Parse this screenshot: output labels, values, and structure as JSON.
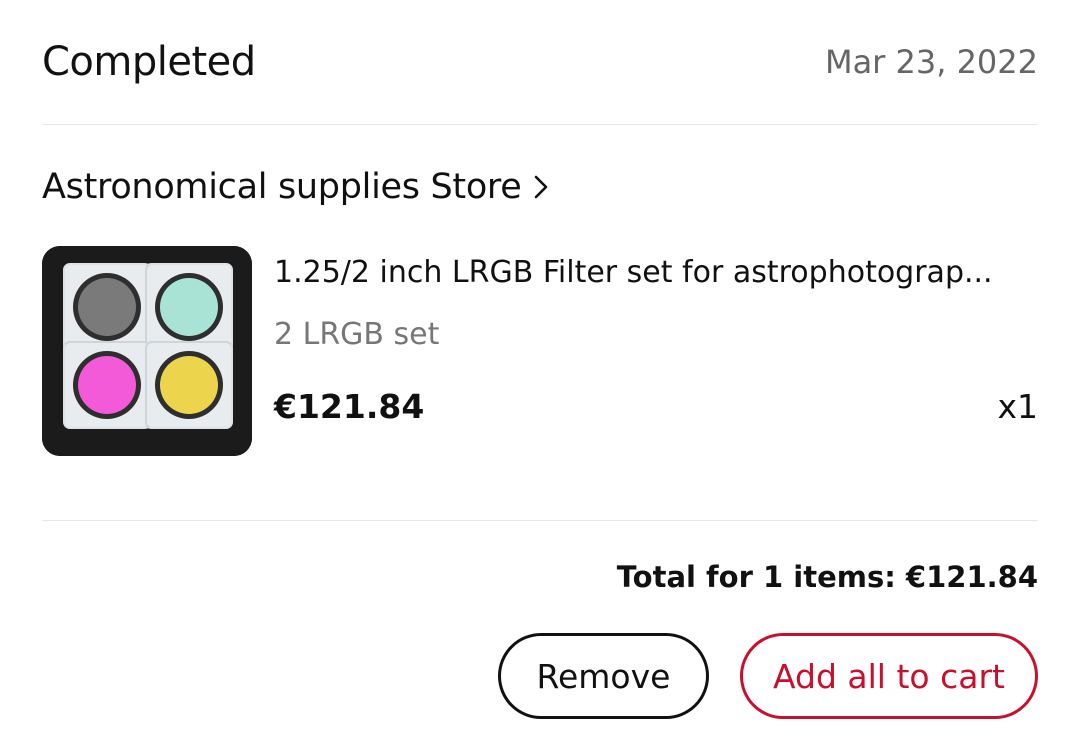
{
  "order": {
    "status": "Completed",
    "date": "Mar 23, 2022"
  },
  "store": {
    "name": "Astronomical supplies Store",
    "chevron_icon": "chevron-right-icon"
  },
  "item": {
    "name": "1.25/2 inch LRGB Filter set for astrophotograp...",
    "variant": "2 LRGB set",
    "price": "€121.84",
    "quantity": "x1",
    "image": "product-thumbnail-filter-set"
  },
  "summary": {
    "total": "Total for 1 items: €121.84"
  },
  "actions": {
    "remove_label": "Remove",
    "add_all_label": "Add all to cart"
  },
  "colors": {
    "accent": "#c8102e",
    "text": "#111111",
    "muted": "#777777",
    "divider": "#e6e6e6"
  }
}
